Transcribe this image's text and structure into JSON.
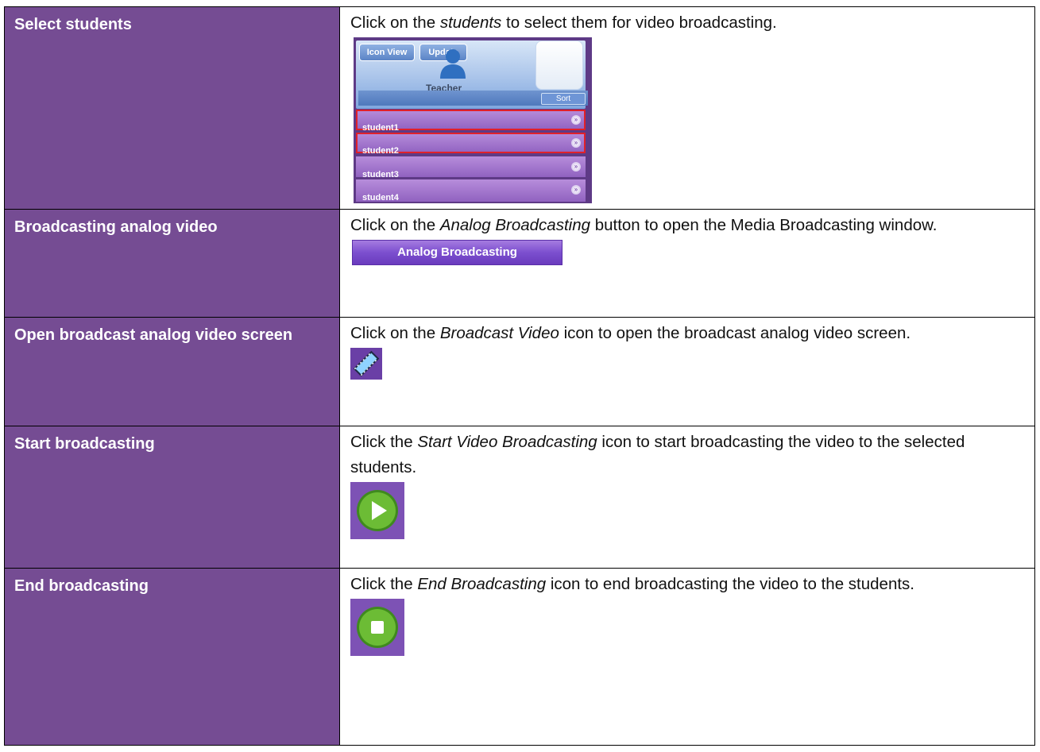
{
  "rows": [
    {
      "label": "Select students",
      "pre": "Click on the ",
      "em": "students",
      "post": " to select them for video broadcasting."
    },
    {
      "label": "Broadcasting analog video",
      "pre": "Click on the ",
      "em": "Analog Broadcasting",
      "post": " button to open the Media Broadcasting window."
    },
    {
      "label": "Open broadcast analog video screen",
      "pre": "Click on the ",
      "em": "Broadcast Video",
      "post": " icon to open the broadcast analog video screen."
    },
    {
      "label": "Start broadcasting",
      "pre": "Click the ",
      "em": "Start Video Broadcasting",
      "post": " icon to start broadcasting the video to the selected students."
    },
    {
      "label": "End broadcasting",
      "pre": "Click the ",
      "em": "End Broadcasting",
      "post": " icon to end broadcasting the video to the students."
    }
  ],
  "panel": {
    "icon_view": "Icon View",
    "update": "Update",
    "teacher": "Teacher",
    "sort": "Sort",
    "students": [
      "student1",
      "student2",
      "student3",
      "student4"
    ],
    "selected": [
      "student1",
      "student2"
    ]
  },
  "analog_button": "Analog Broadcasting",
  "icons": {
    "broadcast_video": "film-strip-icon",
    "start": "play-icon",
    "end": "stop-icon"
  },
  "colors": {
    "label_bg": "#754c93",
    "selection_outline": "#e0202a",
    "icon_green": "#5aa52a"
  }
}
